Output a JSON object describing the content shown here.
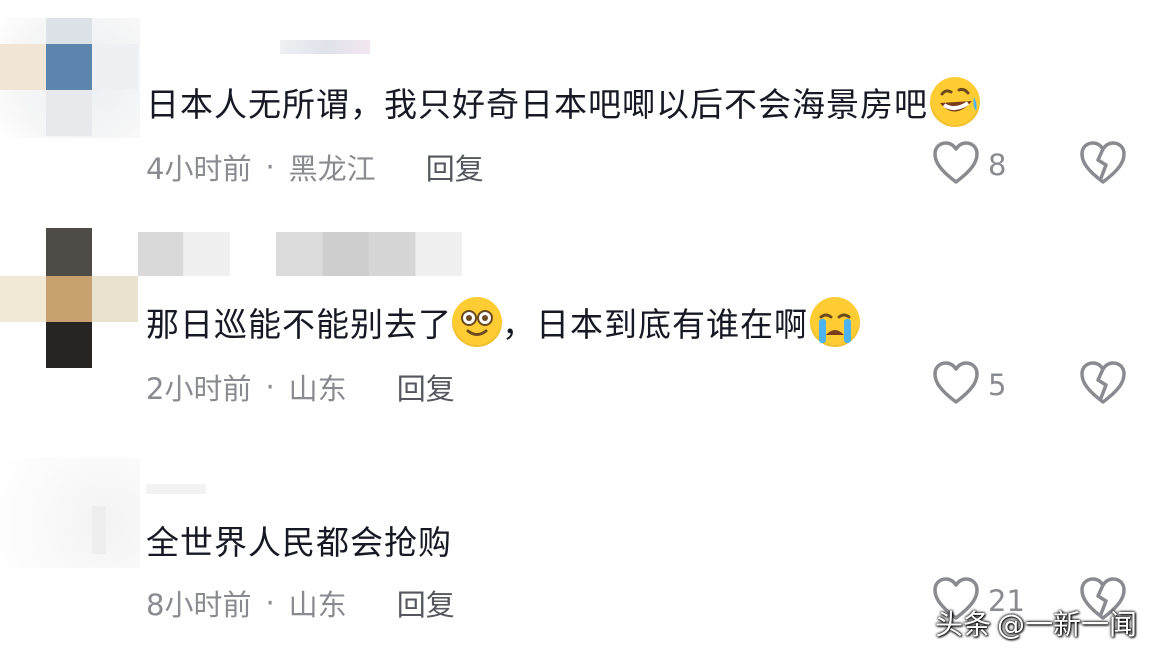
{
  "comments": [
    {
      "text": "日本人无所谓，我只好奇日本吧唧以后不会海景房吧",
      "emoji": "rolling-laughing-emoji",
      "time": "4小时前",
      "location": "黑龙江",
      "reply": "回复",
      "likes": "8"
    },
    {
      "text_before": "那日巡能不能别去了",
      "emoji1": "flushed-smile-emoji",
      "text_after": "，日本到底有谁在啊",
      "emoji2": "crying-emoji",
      "time": "2小时前",
      "location": "山东",
      "reply": "回复",
      "likes": "5"
    },
    {
      "text": "全世界人民都会抢购",
      "time": "8小时前",
      "location": "山东",
      "reply": "回复",
      "likes": "21"
    }
  ],
  "separator": "·",
  "watermark": {
    "platform": "头条",
    "handle": "@一新一闻"
  },
  "colors": {
    "text": "#161823",
    "meta": "#8a8b91",
    "reply": "#55575e",
    "icon": "#8a8b91"
  }
}
